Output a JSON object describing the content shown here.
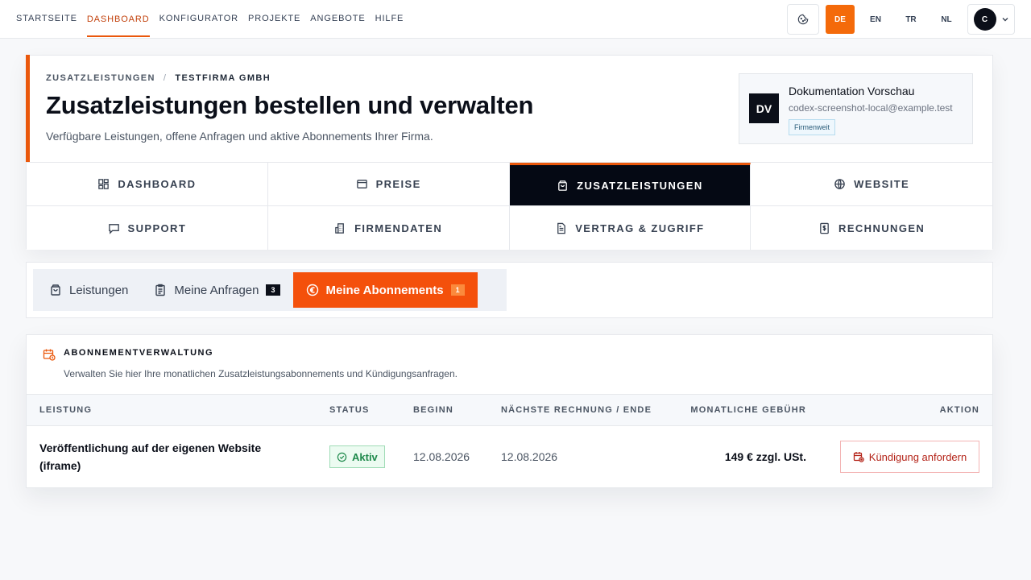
{
  "topnav": {
    "items": [
      "STARTSEITE",
      "DASHBOARD",
      "KONFIGURATOR",
      "PROJEKTE",
      "ANGEBOTE",
      "HILFE"
    ],
    "active": "DASHBOARD"
  },
  "languages": [
    "DE",
    "EN",
    "TR",
    "NL"
  ],
  "active_language": "DE",
  "account": {
    "avatar_initial": "C"
  },
  "header": {
    "breadcrumb": [
      "ZUSATZLEISTUNGEN",
      "/",
      "TESTFIRMA GMBH"
    ],
    "title": "Zusatzleistungen bestellen und verwalten",
    "subtitle": "Verfügbare Leistungen, offene Anfragen und aktive Abonnements Ihrer Firma."
  },
  "user": {
    "initials": "DV",
    "name": "Dokumentation Vorschau",
    "email": "codex-screenshot-local@example.test",
    "badge": "Firmenweit"
  },
  "section_nav": [
    {
      "label": "DASHBOARD",
      "icon": "grid-icon"
    },
    {
      "label": "PREISE",
      "icon": "price-card-icon"
    },
    {
      "label": "ZUSATZLEISTUNGEN",
      "icon": "shopping-bag-icon",
      "active": true
    },
    {
      "label": "WEBSITE",
      "icon": "globe-icon"
    },
    {
      "label": "SUPPORT",
      "icon": "chat-icon"
    },
    {
      "label": "FIRMENDATEN",
      "icon": "building-icon"
    },
    {
      "label": "VERTRAG & ZUGRIFF",
      "icon": "document-icon"
    },
    {
      "label": "RECHNUNGEN",
      "icon": "invoice-icon"
    }
  ],
  "subtabs": [
    {
      "label": "Leistungen",
      "icon": "shopping-bag-icon"
    },
    {
      "label": "Meine Anfragen",
      "icon": "clipboard-icon",
      "count": "3"
    },
    {
      "label": "Meine Abonnements",
      "icon": "euro-icon",
      "count": "1",
      "active": true
    }
  ],
  "subscriptions": {
    "title": "ABONNEMENTVERWALTUNG",
    "description": "Verwalten Sie hier Ihre monatlichen Zusatzleistungsabonnements und Kündigungsanfragen.",
    "columns": [
      "LEISTUNG",
      "STATUS",
      "BEGINN",
      "NÄCHSTE RECHNUNG / ENDE",
      "MONATLICHE GEBÜHR",
      "AKTION"
    ],
    "rows": [
      {
        "service": "Veröffentlichung auf der eigenen Website (iframe)",
        "status": "Aktiv",
        "start": "12.08.2026",
        "next": "12.08.2026",
        "fee": "149 € zzgl. USt.",
        "action": "Kündigung anfordern"
      }
    ]
  },
  "colors": {
    "accent": "#ea580c",
    "active_nav_bg": "#050914",
    "status_green": "#1f8a4c",
    "danger": "#b42318"
  }
}
